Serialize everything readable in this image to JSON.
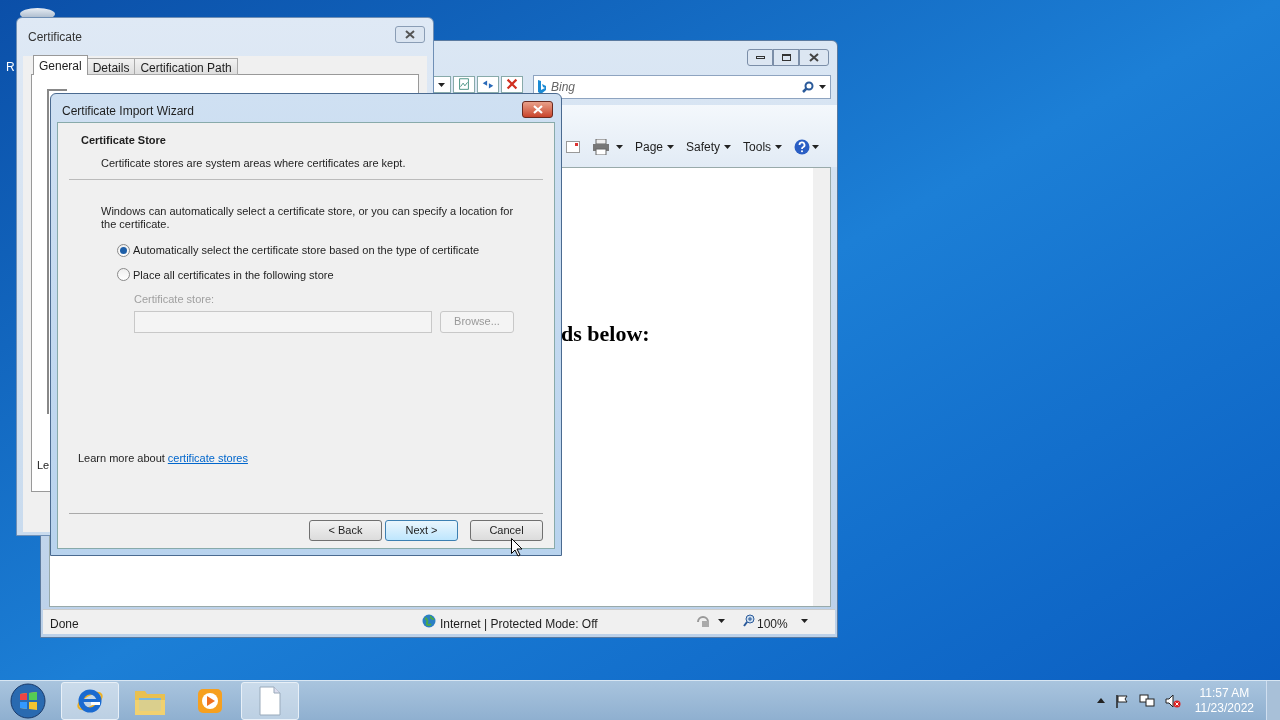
{
  "desktop": {
    "icon_label": "R"
  },
  "browser": {
    "search_placeholder": "Bing",
    "commands": [
      {
        "label": "Page"
      },
      {
        "label": "Safety"
      },
      {
        "label": "Tools"
      }
    ],
    "page_text": "ds below:",
    "status": {
      "text": "Done",
      "zone": "Internet | Protected Mode: Off",
      "zoom": "100%"
    }
  },
  "certificate_window": {
    "title": "Certificate",
    "tabs": [
      {
        "label": "General",
        "selected": true
      },
      {
        "label": "Details",
        "selected": false
      },
      {
        "label": "Certification Path",
        "selected": false
      }
    ],
    "partial_text": "Le"
  },
  "wizard": {
    "title": "Certificate Import Wizard",
    "heading": "Certificate Store",
    "subheading": "Certificate stores are system areas where certificates are kept.",
    "intro": "Windows can automatically select a certificate store, or you can specify a location for the certificate.",
    "options": [
      {
        "label": "Automatically select the certificate store based on the type of certificate",
        "selected": true
      },
      {
        "label": "Place all certificates in the following store",
        "selected": false
      }
    ],
    "store": {
      "label": "Certificate store:",
      "disabled": true
    },
    "browse": {
      "label": "Browse...",
      "disabled": true
    },
    "learn_more": {
      "text": "Learn more about",
      "link": "certificate stores"
    },
    "buttons": [
      {
        "label": "< Back",
        "default": false
      },
      {
        "label": "Next >",
        "default": true
      },
      {
        "label": "Cancel",
        "default": false
      }
    ]
  },
  "taskbar": {
    "items": [
      {
        "kind": "browser",
        "active": true
      },
      {
        "kind": "folder",
        "active": false
      },
      {
        "kind": "media",
        "active": false
      },
      {
        "kind": "document",
        "active": true
      }
    ],
    "time": "11:57 AM",
    "date": "11/23/2022"
  }
}
